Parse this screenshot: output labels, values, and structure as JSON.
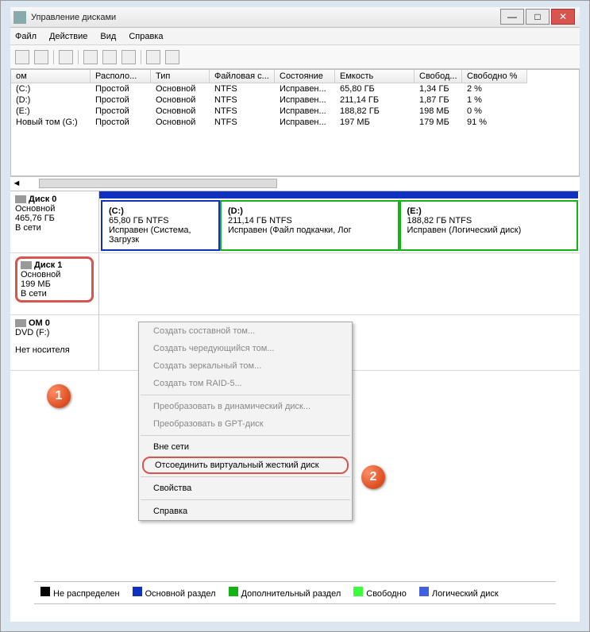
{
  "window": {
    "title": "Управление дисками"
  },
  "menu": {
    "file": "Файл",
    "action": "Действие",
    "view": "Вид",
    "help": "Справка"
  },
  "columns": {
    "c0": "ом",
    "c1": "Располо...",
    "c2": "Тип",
    "c3": "Файловая с...",
    "c4": "Состояние",
    "c5": "Емкость",
    "c6": "Свобод...",
    "c7": "Свободно %"
  },
  "rows": [
    {
      "c0": "(C:)",
      "c1": "Простой",
      "c2": "Основной",
      "c3": "NTFS",
      "c4": "Исправен...",
      "c5": "65,80 ГБ",
      "c6": "1,34 ГБ",
      "c7": "2 %"
    },
    {
      "c0": "(D:)",
      "c1": "Простой",
      "c2": "Основной",
      "c3": "NTFS",
      "c4": "Исправен...",
      "c5": "211,14 ГБ",
      "c6": "1,87 ГБ",
      "c7": "1 %"
    },
    {
      "c0": "(E:)",
      "c1": "Простой",
      "c2": "Основной",
      "c3": "NTFS",
      "c4": "Исправен...",
      "c5": "188,82 ГБ",
      "c6": "198 МБ",
      "c7": "0 %"
    },
    {
      "c0": "Новый том (G:)",
      "c1": "Простой",
      "c2": "Основной",
      "c3": "NTFS",
      "c4": "Исправен...",
      "c5": "197 МБ",
      "c6": "179 МБ",
      "c7": "91 %"
    }
  ],
  "disk0": {
    "name": "Диск 0",
    "type": "Основной",
    "size": "465,76 ГБ",
    "state": "В сети",
    "parts": [
      {
        "name": "(C:)",
        "info": "65,80 ГБ NTFS",
        "status": "Исправен (Система, Загрузк"
      },
      {
        "name": "(D:)",
        "info": "211,14 ГБ NTFS",
        "status": "Исправен (Файл подкачки, Лог"
      },
      {
        "name": "(E:)",
        "info": "188,82 ГБ NTFS",
        "status": "Исправен (Логический диск)"
      }
    ]
  },
  "disk1": {
    "name": "Диск 1",
    "type": "Основной",
    "size": "199 МБ",
    "state": "В сети"
  },
  "dvd": {
    "name": "OM 0",
    "dev": "DVD (F:)",
    "status": "Нет носителя"
  },
  "ctx": {
    "i0": "Создать составной том...",
    "i1": "Создать чередующийся том...",
    "i2": "Создать зеркальный том...",
    "i3": "Создать том RAID-5...",
    "i4": "Преобразовать в динамический диск...",
    "i5": "Преобразовать в GPT-диск",
    "i6": "Вне сети",
    "i7": "Отсоединить виртуальный жесткий диск",
    "i8": "Свойства",
    "i9": "Справка"
  },
  "legend": {
    "l0": "Не распределен",
    "l1": "Основной раздел",
    "l2": "Дополнительный раздел",
    "l3": "Свободно",
    "l4": "Логический диск"
  },
  "markers": {
    "m1": "1",
    "m2": "2"
  }
}
